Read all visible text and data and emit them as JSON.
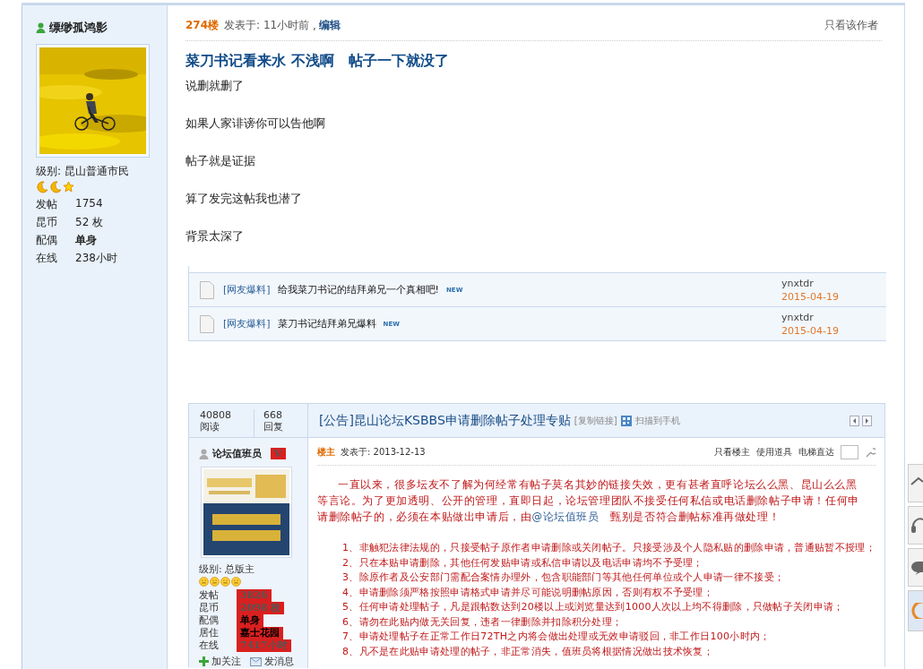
{
  "author": {
    "name": "缥缈孤鸿影",
    "level_label": "级别:",
    "level": "昆山普通市民",
    "rank_icons": [
      {
        "kind": "moon"
      },
      {
        "kind": "moon"
      },
      {
        "kind": "star"
      }
    ],
    "stats": [
      {
        "label": "发帖",
        "value": "1754",
        "emphasis": false
      },
      {
        "label": "昆币",
        "value": "52 枚",
        "emphasis": false
      },
      {
        "label": "配偶",
        "value": "单身",
        "emphasis": true
      },
      {
        "label": "在线",
        "value": "238小时",
        "emphasis": false
      }
    ]
  },
  "post": {
    "floor": "274楼",
    "posted": "发表于: 11小时前",
    "separator": ",",
    "edit": "编辑",
    "only_author": "只看该作者",
    "title": "菜刀书记看来水 不浅啊　帖子一下就没了",
    "paragraphs": [
      "说删就删了",
      "如果人家诽谤你可以告他啊",
      "帖子就是证据",
      "算了发完这帖我也潜了",
      "背景太深了"
    ]
  },
  "thread_list": {
    "rows": [
      {
        "tag": "[网友爆料]",
        "title": "给我菜刀书记的结拜弟兄一个真相吧!",
        "badge": "NEW",
        "author": "ynxtdr",
        "date": "2015-04-19"
      },
      {
        "tag": "[网友爆料]",
        "title": "菜刀书记结拜弟兄爆料",
        "badge": "NEW",
        "author": "ynxtdr",
        "date": "2015-04-19"
      }
    ]
  },
  "embedded_post": {
    "stats": [
      {
        "value": "40808",
        "label": "阅读"
      },
      {
        "value": "668",
        "label": "回复"
      }
    ],
    "title": "[公告]昆山论坛KSBBS申请删除帖子处理专贴",
    "copy_link": "[复制链接]",
    "scan": "扫描到手机",
    "floor": "楼主",
    "posted": "发表于: 2013-12-13",
    "tools": [
      "只看楼主",
      "使用道具",
      "电梯直达"
    ],
    "author": {
      "name": "论坛值班员",
      "badge": "V",
      "level_label": "级别:",
      "level": "总版主",
      "rank_icons": [
        {
          "kind": "face"
        },
        {
          "kind": "face"
        },
        {
          "kind": "face"
        },
        {
          "kind": "face"
        }
      ],
      "stats": [
        {
          "label": "发帖",
          "value": "3826",
          "emphasis": false
        },
        {
          "label": "昆币",
          "value": "2098 枚",
          "emphasis": false
        },
        {
          "label": "配偶",
          "value": "单身",
          "emphasis": true
        },
        {
          "label": "居住",
          "value": "嘉士花园",
          "emphasis": true
        },
        {
          "label": "在线",
          "value": "7417小时",
          "emphasis": false
        }
      ],
      "actions": [
        {
          "kind": "follow",
          "label": "加关注"
        },
        {
          "kind": "message",
          "label": "发消息"
        }
      ]
    },
    "intro": {
      "before": "一直以来，很多坛友不了解为何经常有帖子莫名其妙的链接失效，更有甚者直呼论坛么么黑、昆山么么黑等言论。为了更加透明、公开的管理，直即日起，论坛管理团队不接受任何私信或电话删除帖子申请！任何申请删除帖子的，必须在本贴做出申请后，由",
      "mention": "@论坛值班员",
      "after": "　甄别是否符合删帖标准再做处理！"
    },
    "rules": [
      "1、非触犯法律法规的，只接受帖子原作者申请删除或关闭帖子。只接受涉及个人隐私贴的删除申请，普通贴暂不授理；",
      "2、只在本贴申请删除，其他任何发贴申请或私信申请以及电话申请均不予受理；",
      "3、除原作者及公安部门需配合案情办理外，包含职能部门等其他任何单位或个人申请一律不接受；",
      "4、申请删除须严格按照申请格式申请并尽可能说明删帖原因，否则有权不予受理；",
      "5、任何申请处理帖子，凡是跟帖数达到20楼以上或浏览量达到1000人次以上均不得删除，只做帖子关闭申请；",
      "6、请勿在此贴内做无关回复，违者一律删除并扣除积分处理；",
      "7、申请处理帖子在正常工作日72TH之内将会做出处理或无效申请驳回，非工作日100小时内；",
      "8、凡不是在此贴申请处理的帖子，非正常消失，值班员将根据情况做出技术恢复；"
    ]
  },
  "side_tools": [
    {
      "kind": "top",
      "selected": false
    },
    {
      "kind": "headset",
      "selected": false
    },
    {
      "kind": "chat",
      "selected": false
    },
    {
      "kind": "smile",
      "selected": true
    }
  ]
}
